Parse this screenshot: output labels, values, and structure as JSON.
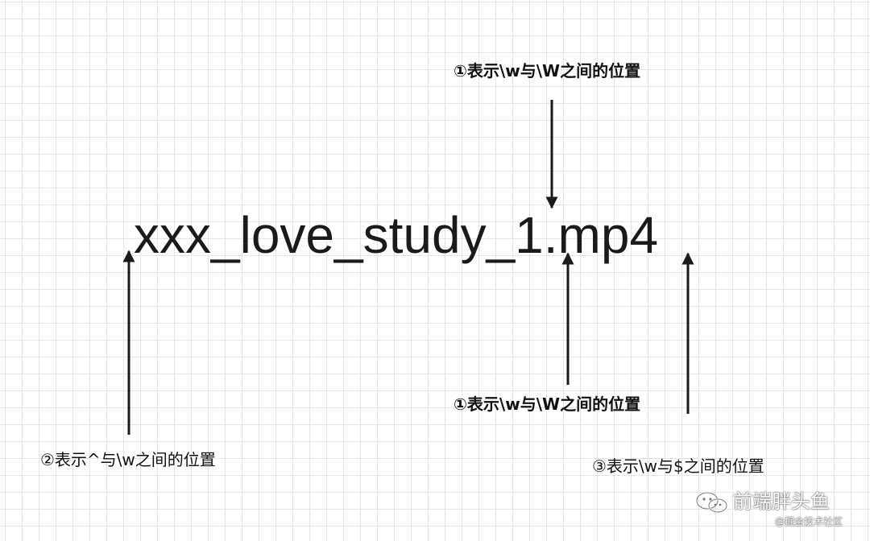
{
  "main_text": "xxx_love_study_1.mp4",
  "labels": {
    "top": "①表示\\w与\\W之间的位置",
    "middle": "①表示\\w与\\W之间的位置",
    "left": "②表示^与\\w之间的位置",
    "right": "③表示\\w与$之间的位置"
  },
  "watermark": {
    "name": "前端胖头鱼",
    "source": "@掘金技术社区",
    "icon": "wechat-icon"
  },
  "colors": {
    "grid": "#e6e6e6",
    "arrow": "#1a1a1a",
    "text": "#111111"
  }
}
